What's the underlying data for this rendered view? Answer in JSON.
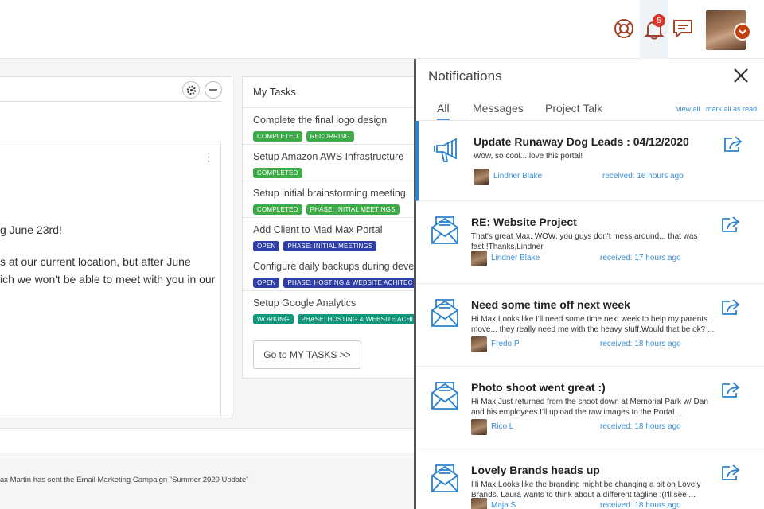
{
  "topbar": {
    "notification_count": "5"
  },
  "left": {
    "lines": [
      "g June 23rd!",
      "s at our current location, but after June",
      "ich we won't be able to meet with you in our"
    ],
    "bottom_text": "ax Martin has sent the Email Marketing Campaign \"Summer 2020 Update\""
  },
  "tasks": {
    "title": "My Tasks",
    "button_label": "Go to MY TASKS >>",
    "items": [
      {
        "name": "Complete the final logo design",
        "tags": [
          {
            "label": "COMPLETED",
            "color": "#3dab48"
          },
          {
            "label": "RECURRING",
            "color": "#3dab48"
          }
        ]
      },
      {
        "name": "Setup Amazon AWS Infrastructure",
        "tags": [
          {
            "label": "COMPLETED",
            "color": "#3dab48"
          }
        ]
      },
      {
        "name": "Setup initial brainstorming meeting",
        "tags": [
          {
            "label": "COMPLETED",
            "color": "#3dab48"
          },
          {
            "label": "PHASE: INITIAL MEETINGS",
            "color": "#3dab48"
          }
        ]
      },
      {
        "name": "Add Client to Mad Max Portal",
        "tags": [
          {
            "label": "OPEN",
            "color": "#2f3fa8"
          },
          {
            "label": "PHASE: INITIAL MEETINGS",
            "color": "#2f3fa8"
          }
        ]
      },
      {
        "name": "Configure daily backups during develo",
        "tags": [
          {
            "label": "OPEN",
            "color": "#2f3fa8"
          },
          {
            "label": "PHASE: HOSTING & WEBSITE ACHITEC",
            "color": "#2f3fa8"
          }
        ]
      },
      {
        "name": "Setup Google Analytics",
        "tags": [
          {
            "label": "WORKING",
            "color": "#12977c"
          },
          {
            "label": "PHASE: HOSTING & WEBSITE ACHI",
            "color": "#12977c"
          }
        ]
      }
    ]
  },
  "notifications": {
    "title": "Notifications",
    "tabs": [
      "All",
      "Messages",
      "Project Talk"
    ],
    "view_all": "view all",
    "mark_all_read": "mark all as read",
    "items": [
      {
        "icon": "megaphone-icon",
        "title": "Update Runaway Dog Leads : 04/12/2020",
        "body": "Wow, so cool... love this portal!",
        "sender": "Lindner Blake",
        "time": "received: 16 hours ago"
      },
      {
        "icon": "envelope-icon",
        "title": "RE: Website Project",
        "body": "That's great Max.  WOW, you guys don't mess around... that was fast!!Thanks,Lindner",
        "sender": "Lindner Blake",
        "time": "received: 17 hours ago"
      },
      {
        "icon": "envelope-icon",
        "title": "Need some time off next week",
        "body": "Hi Max,Looks like I'll need some time next week to help my parents move... they really need me with the heavy stuff.Would that be ok? ...",
        "sender": "Fredo P",
        "time": "received: 18 hours ago"
      },
      {
        "icon": "envelope-icon",
        "title": "Photo shoot went great :)",
        "body": "Hi Max,Just returned from the shoot down at Memorial Park w/ Dan and his employees.I'll upload the raw images to the Portal ...",
        "sender": "Rico L",
        "time": "received: 18 hours ago"
      },
      {
        "icon": "envelope-icon",
        "title": "Lovely Brands heads up",
        "body": "Hi Max,Looks like the branding might be changing a bit on Lovely Brands. Laura wants to think about a different tagline :(I'll see ...",
        "sender": "Maja S",
        "time": "received: 18 hours ago"
      }
    ]
  },
  "colors": {
    "accent": "#3a8fd6",
    "badge": "#d9362b"
  }
}
